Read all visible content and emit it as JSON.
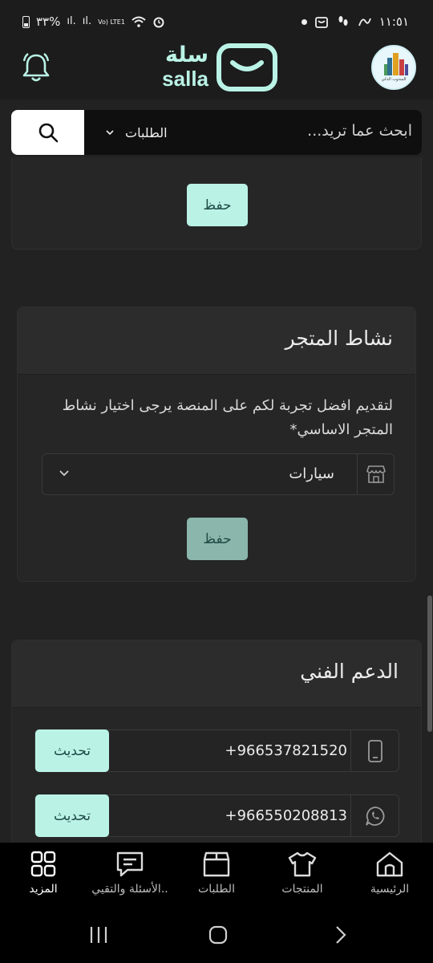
{
  "status_bar": {
    "battery": "٣٣%",
    "network": "Vo) LTE1",
    "time": "١١:٥١"
  },
  "header": {
    "logo_ar": "سلة",
    "logo_en": "salla",
    "avatar_caption": "المندوب الذكي"
  },
  "search": {
    "placeholder": "ابحث عما تريد...",
    "category": "الطلبات"
  },
  "top_section": {
    "save_label": "حفظ"
  },
  "store_activity": {
    "title": "نشاط المتجر",
    "description": "لتقديم افضل تجربة لكم على المنصة يرجى اختيار نشاط المتجر الاساسي*",
    "selected_value": "سيارات",
    "save_label": "حفظ"
  },
  "support": {
    "title": "الدعم الفني",
    "rows": [
      {
        "icon": "mobile-phone-icon",
        "value": "+966537821520",
        "button": "تحديث"
      },
      {
        "icon": "whatsapp-icon",
        "value": "+966550208813",
        "button": "تحديث"
      }
    ]
  },
  "bottom_nav": {
    "items": [
      {
        "icon": "home-icon",
        "label": "الرئيسية"
      },
      {
        "icon": "shirt-icon",
        "label": "المنتجات"
      },
      {
        "icon": "box-icon",
        "label": "الطلبات"
      },
      {
        "icon": "chat-icon",
        "label": "الأسئلة والتقيي.."
      },
      {
        "icon": "grid-icon",
        "label": "المزيد",
        "active": true
      }
    ]
  },
  "colors": {
    "accent": "#baf3e6",
    "background": "#222222",
    "card": "#262626"
  }
}
